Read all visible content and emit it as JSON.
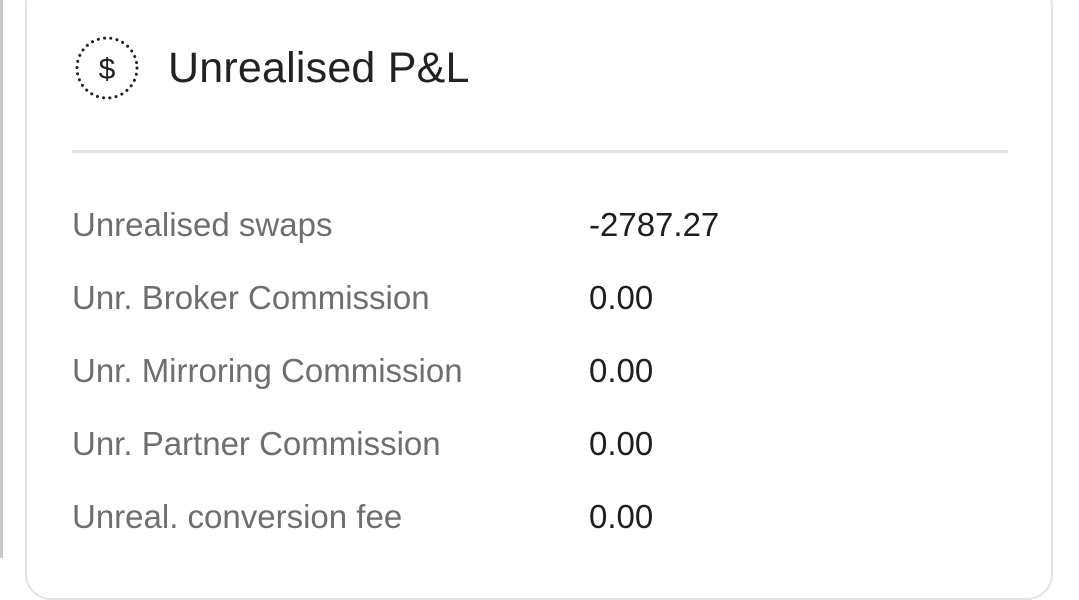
{
  "panel": {
    "title": "Unrealised P&L",
    "icon": "dollar-circle-icon",
    "rows": [
      {
        "label": "Unrealised swaps",
        "value": "-2787.27"
      },
      {
        "label": "Unr. Broker Commission",
        "value": "0.00"
      },
      {
        "label": "Unr. Mirroring Commission",
        "value": "0.00"
      },
      {
        "label": "Unr. Partner Commission",
        "value": "0.00"
      },
      {
        "label": "Unreal. conversion fee",
        "value": "0.00"
      }
    ]
  },
  "colors": {
    "title": "#222222",
    "label": "#6e6e6e",
    "value": "#1e1e1e",
    "border": "#e3e3e3"
  }
}
